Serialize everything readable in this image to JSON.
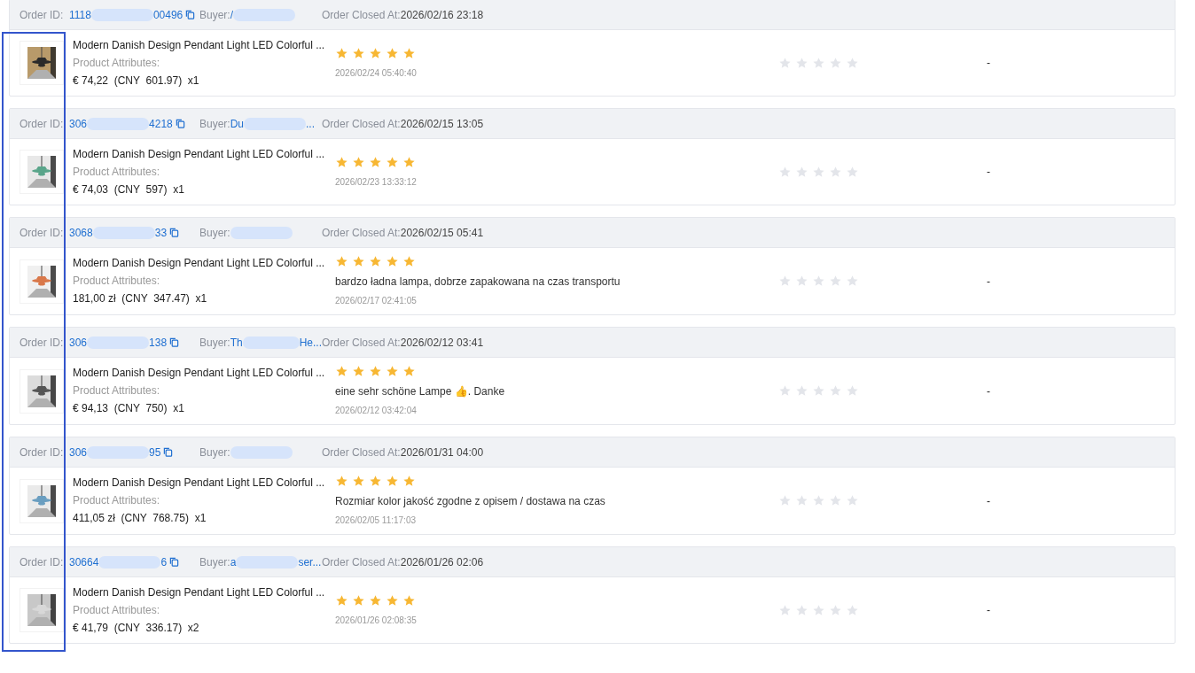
{
  "orders": [
    {
      "order_id_label": "Order ID:",
      "order_id_start": "1118",
      "order_id_end": "00496",
      "buyer_label": "Buyer:",
      "buyer_start": "/",
      "closed_label": "Order Closed At:",
      "closed_at": "2026/02/16 23:18",
      "product": {
        "kind": "picture",
        "title": "Modern Danish Design Pendant Light LED Colorful ...",
        "attributes_label": "Product Attributes:",
        "price": "€ 74,22  (CNY  601.97)  x1"
      },
      "review": {
        "stars": 5,
        "date": "2026/02/24 05:40:40"
      },
      "second_rating": {
        "stars": 0
      },
      "reply": "-"
    },
    {
      "order_id_label": "Order ID:",
      "order_id_start": "306",
      "order_id_end": "4218",
      "buyer_label": "Buyer:",
      "buyer_start": "Du",
      "buyer_end": "...",
      "closed_label": "Order Closed At:",
      "closed_at": "2026/02/15 13:05",
      "product": {
        "kind": "picture",
        "title": "Modern Danish Design Pendant Light LED Colorful ...",
        "attributes_label": "Product Attributes:",
        "price": "€ 74,03  (CNY  597)  x1"
      },
      "review": {
        "stars": 5,
        "date": "2026/02/23 13:33:12"
      },
      "second_rating": {
        "stars": 0
      },
      "reply": "-"
    },
    {
      "order_id_label": "Order ID:",
      "order_id_start": "3068",
      "order_id_end": "33",
      "buyer_label": "Buyer:",
      "closed_label": "Order Closed At:",
      "closed_at": "2026/02/15 05:41",
      "product": {
        "kind": "picture",
        "title": "Modern Danish Design Pendant Light LED Colorful ...",
        "attributes_label": "Product Attributes:",
        "price": "181,00 zł  (CNY  347.47)  x1"
      },
      "review": {
        "stars": 5,
        "comment": "bardzo ładna lampa, dobrze zapakowana na czas transportu",
        "date": "2026/02/17 02:41:05"
      },
      "second_rating": {
        "stars": 0
      },
      "reply": "-"
    },
    {
      "order_id_label": "Order ID:",
      "order_id_start": "306",
      "order_id_end": "138",
      "buyer_label": "Buyer:",
      "buyer_start": "Th",
      "buyer_end": "He...",
      "closed_label": "Order Closed At:",
      "closed_at": "2026/02/12 03:41",
      "product": {
        "kind": "picture",
        "title": "Modern Danish Design Pendant Light LED Colorful ...",
        "attributes_label": "Product Attributes:",
        "price": "€ 94,13  (CNY  750)  x1"
      },
      "review": {
        "stars": 5,
        "comment": "eine sehr schöne Lampe 👍. Danke",
        "date": "2026/02/12 03:42:04"
      },
      "second_rating": {
        "stars": 0
      },
      "reply": "-"
    },
    {
      "order_id_label": "Order ID:",
      "order_id_start": "306",
      "order_id_end": "95",
      "buyer_label": "Buyer:",
      "closed_label": "Order Closed At:",
      "closed_at": "2026/01/31 04:00",
      "product": {
        "kind": "picture",
        "title": "Modern Danish Design Pendant Light LED Colorful ...",
        "attributes_label": "Product Attributes:",
        "price": "411,05 zł  (CNY  768.75)  x1"
      },
      "review": {
        "stars": 5,
        "comment": "Rozmiar kolor jakość zgodne z opisem / dostawa na czas",
        "date": "2026/02/05 11:17:03"
      },
      "second_rating": {
        "stars": 0
      },
      "reply": "-"
    },
    {
      "order_id_label": "Order ID:",
      "order_id_start": "30664",
      "order_id_end": "6",
      "buyer_label": "Buyer:",
      "buyer_start": "a",
      "buyer_end": "ser...",
      "closed_label": "Order Closed At:",
      "closed_at": "2026/01/26 02:06",
      "product": {
        "kind": "picture",
        "title": "Modern Danish Design Pendant Light LED Colorful ...",
        "attributes_label": "Product Attributes:",
        "price": "€ 41,79  (CNY  336.17)  x2"
      },
      "review": {
        "stars": 5,
        "date": "2026/01/26 02:08:35"
      },
      "second_rating": {
        "stars": 0
      },
      "reply": "-"
    }
  ]
}
